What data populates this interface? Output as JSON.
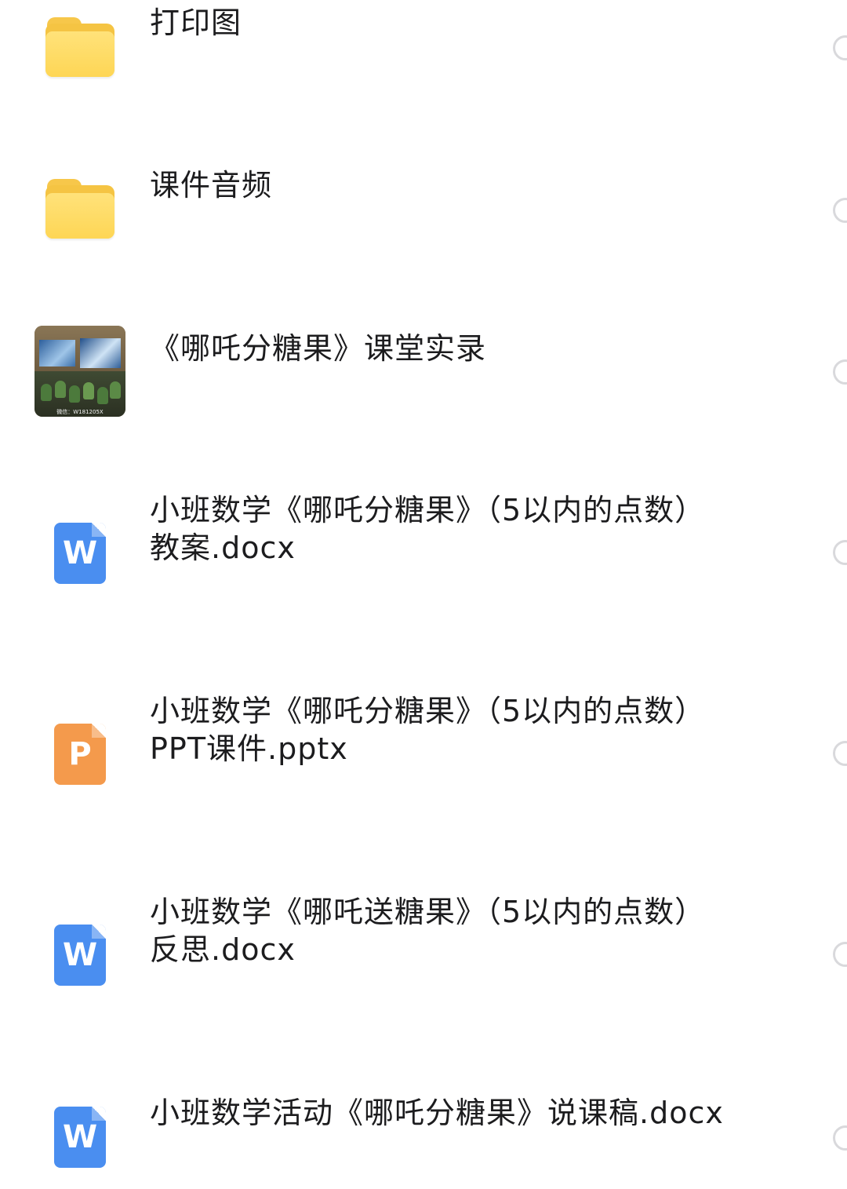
{
  "files": [
    {
      "name": "打印图",
      "type": "folder",
      "icon": "folder-icon"
    },
    {
      "name": "课件音频",
      "type": "folder",
      "icon": "folder-icon"
    },
    {
      "name": "《哪吒分糖果》课堂实录",
      "type": "video",
      "icon": "video-thumbnail",
      "thumbnail_caption": "微信：W181205X"
    },
    {
      "name": "小班数学《哪吒分糖果》（5以内的点数）\n教案.docx",
      "type": "docx",
      "icon": "word-doc-icon",
      "icon_letter": "W",
      "icon_color": "#4a8ef0"
    },
    {
      "name": "小班数学《哪吒分糖果》（5以内的点数）\nPPT课件.pptx",
      "type": "pptx",
      "icon": "ppt-doc-icon",
      "icon_letter": "P",
      "icon_color": "#f49a4c"
    },
    {
      "name": "小班数学《哪吒送糖果》（5以内的点数）\n反思.docx",
      "type": "docx",
      "icon": "word-doc-icon",
      "icon_letter": "W",
      "icon_color": "#4a8ef0"
    },
    {
      "name": "小班数学活动《哪吒分糖果》说课稿.docx",
      "type": "docx",
      "icon": "word-doc-icon",
      "icon_letter": "W",
      "icon_color": "#4a8ef0"
    }
  ]
}
